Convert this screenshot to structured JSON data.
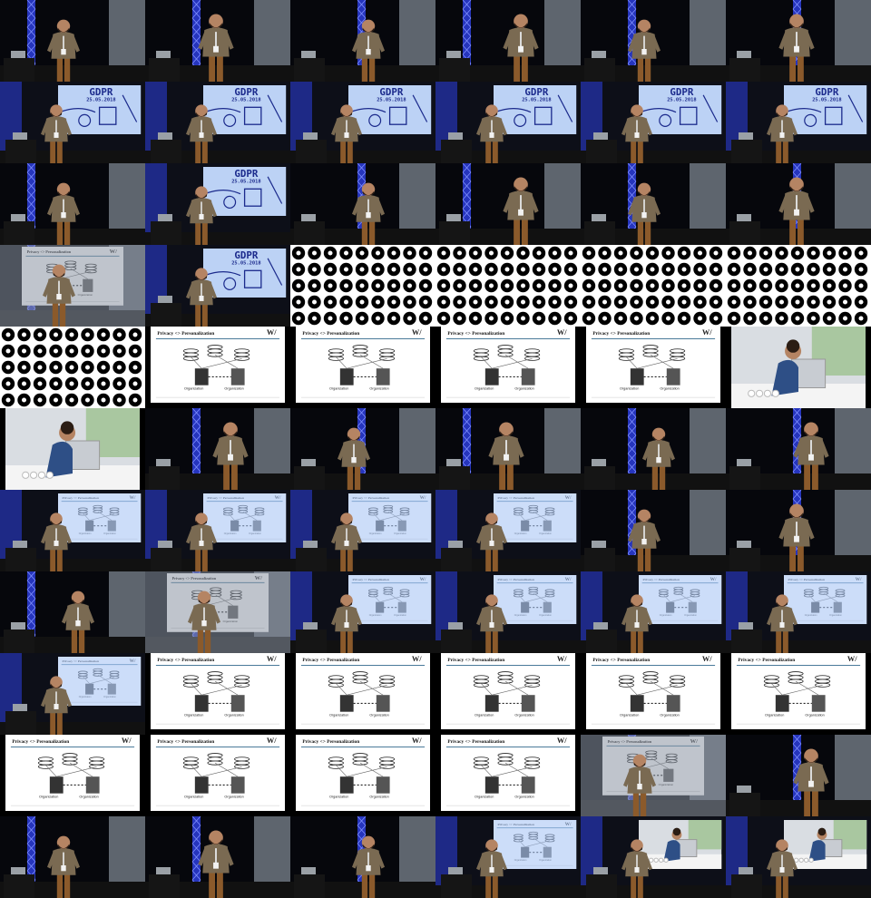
{
  "grid": {
    "columns": 6,
    "rows": 11
  },
  "slides": {
    "gdpr_title": "GDPR",
    "gdpr_date": "25.05.2018",
    "privacy_title": "Privacy <> Personalization",
    "org_label": "Organization",
    "logo_text": "W/"
  },
  "frame_kinds": {
    "stage": "speaker on stage",
    "gdpr": "speaker in front of GDPR slide",
    "icons": "social media icons slide",
    "privacy": "Privacy <> Personalization slide",
    "privacy_stage": "speaker in front of Privacy <> Personalization slide",
    "photo": "frustrated man at laptop photo",
    "photo_stage": "speaker in front of laptop photo slide",
    "fade": "crossfade transition"
  },
  "colors": {
    "blue_light": "#2a3bd0",
    "screen_blue": "#bcd2f5",
    "slide_white": "#ffffff",
    "jacket": "#7a6a52"
  },
  "tiles": [
    "stage",
    "stage",
    "stage",
    "stage",
    "stage",
    "stage",
    "gdpr",
    "gdpr",
    "gdpr",
    "gdpr",
    "gdpr",
    "gdpr",
    "stage",
    "gdpr",
    "stage",
    "stage",
    "stage",
    "stage",
    "fade",
    "gdpr",
    "icons",
    "icons",
    "icons",
    "icons",
    "icons",
    "privacy",
    "privacy",
    "privacy",
    "privacy",
    "photo",
    "photo",
    "stage",
    "stage",
    "stage",
    "stage",
    "stage",
    "privacy_stage",
    "privacy_stage",
    "privacy_stage",
    "privacy_stage",
    "stage",
    "stage",
    "stage",
    "fade",
    "privacy_stage",
    "privacy_stage",
    "privacy_stage",
    "privacy_stage",
    "privacy_stage",
    "privacy",
    "privacy",
    "privacy",
    "privacy",
    "privacy",
    "privacy",
    "privacy",
    "privacy",
    "privacy",
    "fade",
    "stage",
    "stage",
    "stage",
    "stage",
    "privacy_stage",
    "photo_stage",
    "photo_stage"
  ]
}
